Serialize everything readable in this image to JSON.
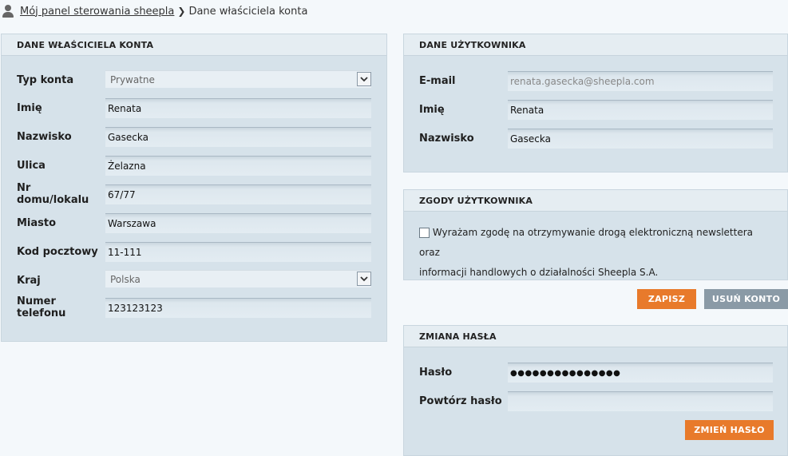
{
  "breadcrumb": {
    "home": "Mój panel sterowania sheepla",
    "current": "Dane właściciela konta"
  },
  "owner": {
    "title": "DANE WŁAŚCICIELA KONTA",
    "account_type_label": "Typ konta",
    "account_type_value": "Prywatne",
    "first_name_label": "Imię",
    "first_name_value": "Renata",
    "last_name_label": "Nazwisko",
    "last_name_value": "Gasecka",
    "street_label": "Ulica",
    "street_value": "Żelazna",
    "house_label": "Nr domu/lokalu",
    "house_value": "67/77",
    "city_label": "Miasto",
    "city_value": "Warszawa",
    "postal_label": "Kod pocztowy",
    "postal_value": "11-111",
    "country_label": "Kraj",
    "country_value": "Polska",
    "phone_label": "Numer telefonu",
    "phone_value": "123123123"
  },
  "user": {
    "title": "DANE UŻYTKOWNIKA",
    "email_label": "E-mail",
    "email_value": "renata.gasecka@sheepla.com",
    "first_name_label": "Imię",
    "first_name_value": "Renata",
    "last_name_label": "Nazwisko",
    "last_name_value": "Gasecka"
  },
  "consents": {
    "title": "ZGODY UŻYTKOWNIKA",
    "newsletter_text_line1": "Wyrażam zgodę na otrzymywanie drogą elektroniczną newslettera oraz",
    "newsletter_text_line2": "informacji handlowych o działalności Sheepla S.A.",
    "newsletter_checked": false
  },
  "actions": {
    "save_label": "ZAPISZ",
    "delete_label": "USUŃ KONTO"
  },
  "password": {
    "title": "ZMIANA HASŁA",
    "password_label": "Hasło",
    "password_value": "●●●●●●●●●●●●●●●",
    "repeat_label": "Powtórz hasło",
    "repeat_value": "",
    "change_label": "ZMIEŃ HASŁO"
  },
  "colors": {
    "accent": "#e87a2b",
    "secondary_button": "#8a9aa6",
    "panel_bg": "#d6e2ea"
  }
}
